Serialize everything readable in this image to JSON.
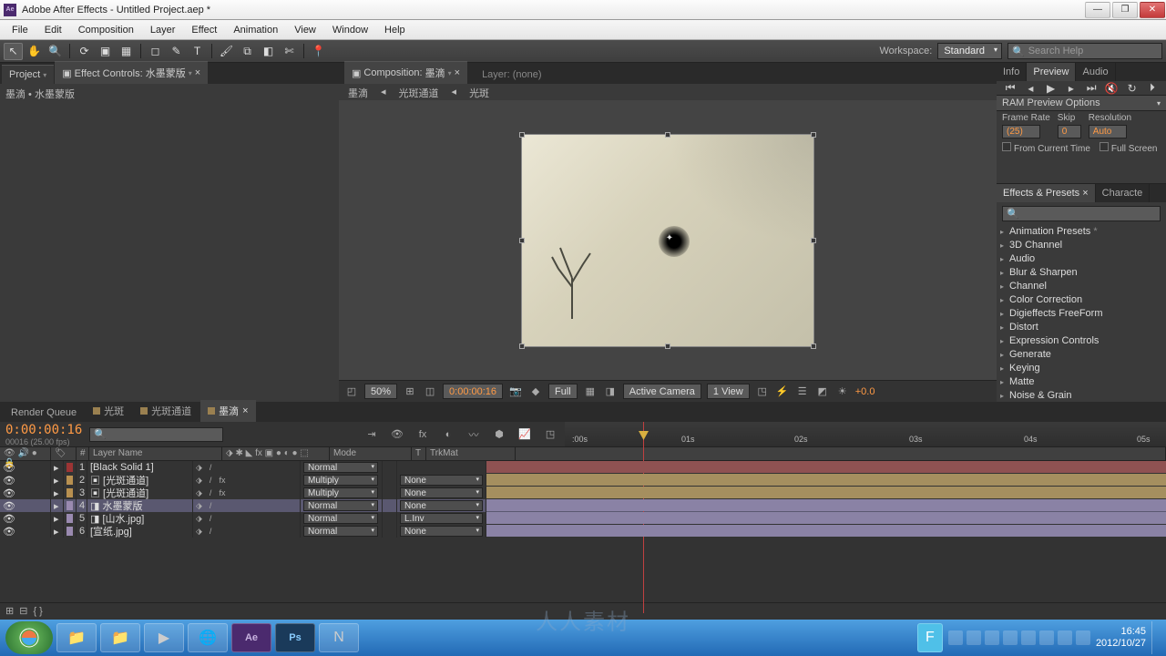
{
  "title": "Adobe After Effects - Untitled Project.aep *",
  "menu": [
    "File",
    "Edit",
    "Composition",
    "Layer",
    "Effect",
    "Animation",
    "View",
    "Window",
    "Help"
  ],
  "workspace": {
    "label": "Workspace:",
    "value": "Standard"
  },
  "search": {
    "placeholder": "Search Help"
  },
  "project": {
    "tab1": "Project",
    "tab2": "Effect Controls: 水墨蒙版",
    "crumb": "墨滴 • 水墨蒙版"
  },
  "comp": {
    "tabPrefix": "Composition:",
    "tabName": "墨滴",
    "layerTab": "Layer: (none)",
    "crumbs": [
      "墨滴",
      "光斑通道",
      "光斑"
    ],
    "zoom": "50%",
    "time": "0:00:00:16",
    "res": "Full",
    "camera": "Active Camera",
    "views": "1 View",
    "exposure": "+0.0"
  },
  "right": {
    "tabs": [
      "Info",
      "Preview",
      "Audio"
    ],
    "ram": "RAM Preview Options",
    "fr_label": "Frame Rate",
    "fr_val": "(25)",
    "skip_label": "Skip",
    "skip_val": "0",
    "res_label": "Resolution",
    "res_val": "Auto",
    "fromCurrent": "From Current Time",
    "fullScreen": "Full Screen",
    "fxTab": "Effects & Presets",
    "charTab": "Characte",
    "fxItems": [
      "Animation Presets",
      "3D Channel",
      "Audio",
      "Blur & Sharpen",
      "Channel",
      "Color Correction",
      "Digieffects FreeForm",
      "Distort",
      "Expression Controls",
      "Generate",
      "Keying",
      "Matte",
      "Noise & Grain"
    ]
  },
  "timeline": {
    "tabs": [
      "Render Queue",
      "光斑",
      "光斑通道",
      "墨滴"
    ],
    "activeTab": 3,
    "timecode": "0:00:00:16",
    "subtc": "00016 (25.00 fps)",
    "cols": {
      "name": "Layer Name",
      "mode": "Mode",
      "t": "T",
      "trk": "TrkMat"
    },
    "ruler": [
      ":00s",
      "01s",
      "02s",
      "03s",
      "04s",
      "05s"
    ],
    "layers": [
      {
        "num": 1,
        "name": "[Black Solid 1]",
        "swatch": "#9c3434",
        "mode": "Normal",
        "trk": "",
        "bar": "#8f5252",
        "fx": false
      },
      {
        "num": 2,
        "name": "[光斑通道]",
        "swatch": "#b89050",
        "mode": "Multiply",
        "trk": "None",
        "bar": "#a58f5f",
        "fx": true
      },
      {
        "num": 3,
        "name": "[光斑通道]",
        "swatch": "#b89050",
        "mode": "Multiply",
        "trk": "None",
        "bar": "#a58f5f",
        "fx": true
      },
      {
        "num": 4,
        "name": "水墨蒙版",
        "swatch": "#9a8ab0",
        "mode": "Normal",
        "trk": "None",
        "bar": "#8a82a5",
        "fx": false,
        "sel": true
      },
      {
        "num": 5,
        "name": "[山水.jpg]",
        "swatch": "#9a8ab0",
        "mode": "Normal",
        "trk": "L.Inv",
        "bar": "#8a82a5",
        "fx": false
      },
      {
        "num": 6,
        "name": "[宣纸.jpg]",
        "swatch": "#9a8ab0",
        "mode": "Normal",
        "trk": "None",
        "bar": "#8a82a5",
        "fx": false
      }
    ]
  },
  "taskbar": {
    "time": "16:45",
    "date": "2012/10/27"
  },
  "watermark": "人人素材"
}
